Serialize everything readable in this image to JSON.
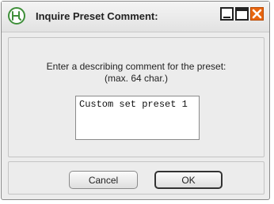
{
  "window": {
    "title": "Inquire Preset Comment:",
    "icon": "app-logo-icon",
    "controls": [
      "minimize-icon",
      "maximize-icon",
      "close-icon"
    ],
    "accent_close": "#e8650f"
  },
  "dialog": {
    "prompt_line1": "Enter a describing comment for the preset:",
    "prompt_line2": "(max. 64 char.)",
    "comment_value": "Custom set preset 1"
  },
  "buttons": {
    "cancel_label": "Cancel",
    "ok_label": "OK"
  }
}
